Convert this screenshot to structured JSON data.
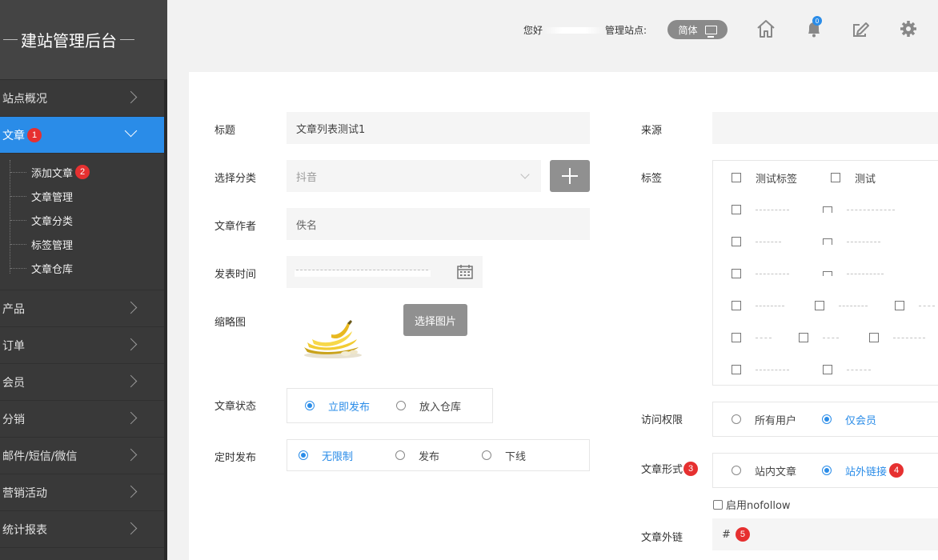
{
  "sidebar": {
    "brand": "建站管理后台",
    "items": [
      {
        "label": "站点概况",
        "active": false
      },
      {
        "label": "文章",
        "active": true,
        "badge": "1"
      },
      {
        "label": "产品",
        "active": false
      },
      {
        "label": "订单",
        "active": false
      },
      {
        "label": "会员",
        "active": false
      },
      {
        "label": "分销",
        "active": false
      },
      {
        "label": "邮件/短信/微信",
        "active": false
      },
      {
        "label": "营销活动",
        "active": false
      },
      {
        "label": "统计报表",
        "active": false
      }
    ],
    "sub_items": [
      {
        "label": "添加文章",
        "badge": "2"
      },
      {
        "label": "文章管理"
      },
      {
        "label": "文章分类"
      },
      {
        "label": "标签管理"
      },
      {
        "label": "文章仓库"
      }
    ]
  },
  "header": {
    "greeting_prefix": "您好",
    "manage_site_label": "管理站点:",
    "lang_label": "简体",
    "notification_count": "0",
    "accent": "#2a8ce8"
  },
  "form": {
    "title_label": "标题",
    "title_value": "文章列表测试1",
    "category_label": "选择分类",
    "category_value": "抖音",
    "author_label": "文章作者",
    "author_value": "佚名",
    "publish_time_label": "发表时间",
    "thumbnail_label": "缩略图",
    "choose_image_label": "选择图片",
    "status_label": "文章状态",
    "status_options": [
      "立即发布",
      "放入仓库"
    ],
    "status_selected": "立即发布",
    "schedule_label": "定时发布",
    "schedule_options": [
      "无限制",
      "发布",
      "下线"
    ],
    "schedule_selected": "无限制",
    "source_label": "来源",
    "source_value": "",
    "tags_label": "标签",
    "tags": [
      "测试标签",
      "测试"
    ],
    "access_label": "访问权限",
    "access_options": [
      "所有用户",
      "仅会员"
    ],
    "access_selected": "仅会员",
    "form_type_label": "文章形式",
    "form_type_badge": "3",
    "form_type_options": [
      "站内文章",
      "站外链接"
    ],
    "form_type_selected": "站外链接",
    "form_type_option_badge": "4",
    "nofollow_label": "启用nofollow",
    "external_link_label": "文章外链",
    "external_link_value": "#",
    "external_link_badge": "5"
  }
}
